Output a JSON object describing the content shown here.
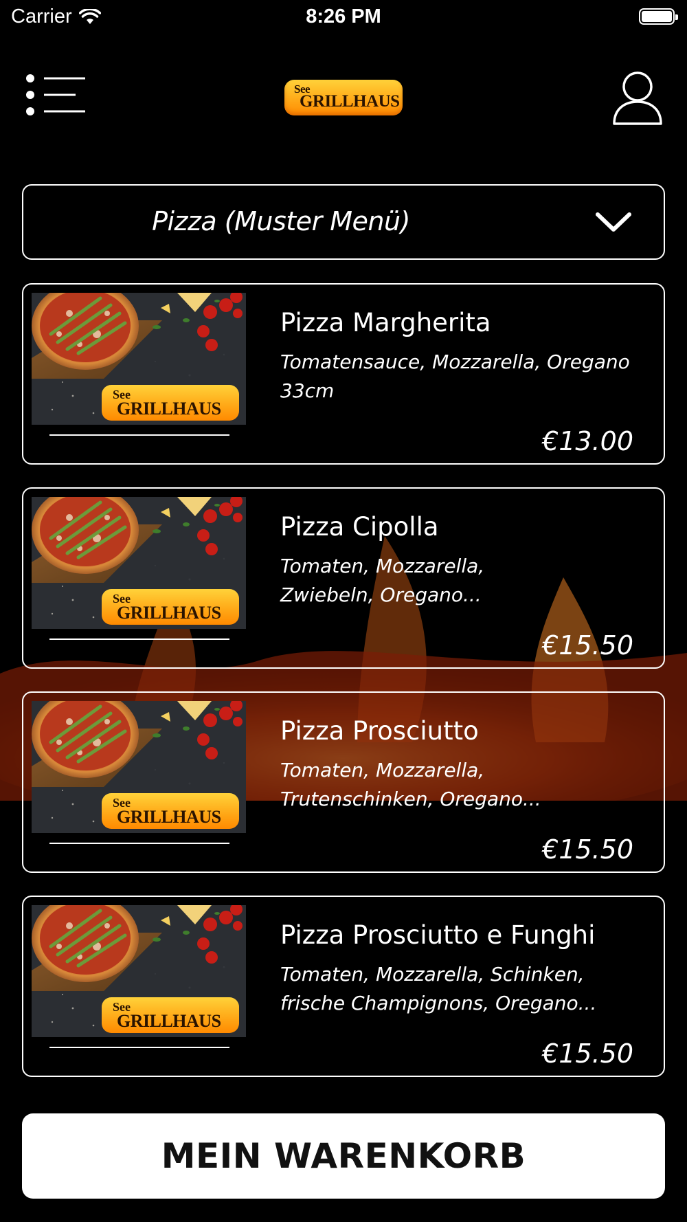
{
  "status_bar": {
    "carrier": "Carrier",
    "time": "8:26 PM"
  },
  "header": {
    "logo_small": "See",
    "logo_main": "GRILLHAUS"
  },
  "category": {
    "selected": "Pizza (Muster Menü)"
  },
  "items": [
    {
      "name": "Pizza Margherita",
      "description": "Tomatensauce, Mozzarella, Oregano 33cm",
      "price": "€13.00",
      "badge_small": "See",
      "badge_main": "GRILLHAUS"
    },
    {
      "name": "Pizza Cipolla",
      "description": "Tomaten, Mozzarella, Zwiebeln, Oregano...",
      "price": "€15.50",
      "badge_small": "See",
      "badge_main": "GRILLHAUS"
    },
    {
      "name": "Pizza Prosciutto",
      "description": "Tomaten, Mozzarella, Trutenschinken, Oregano...",
      "price": "€15.50",
      "badge_small": "See",
      "badge_main": "GRILLHAUS"
    },
    {
      "name": "Pizza Prosciutto e Funghi",
      "description": "Tomaten, Mozzarella, Schinken, frische Champignons, Oregano...",
      "price": "€15.50",
      "badge_small": "See",
      "badge_main": "GRILLHAUS"
    }
  ],
  "cart": {
    "label": "MEIN WARENKORB"
  },
  "icons": {
    "menu": "menu-list-icon",
    "profile": "user-icon",
    "dropdown": "chevron-down-icon",
    "wifi": "wifi-icon",
    "battery": "battery-icon"
  },
  "colors": {
    "background": "#000000",
    "logo_gradient_top": "#ffd23a",
    "logo_gradient_bottom": "#ff8a00",
    "card_border": "#ffffff",
    "cart_button": "#ffffff"
  }
}
